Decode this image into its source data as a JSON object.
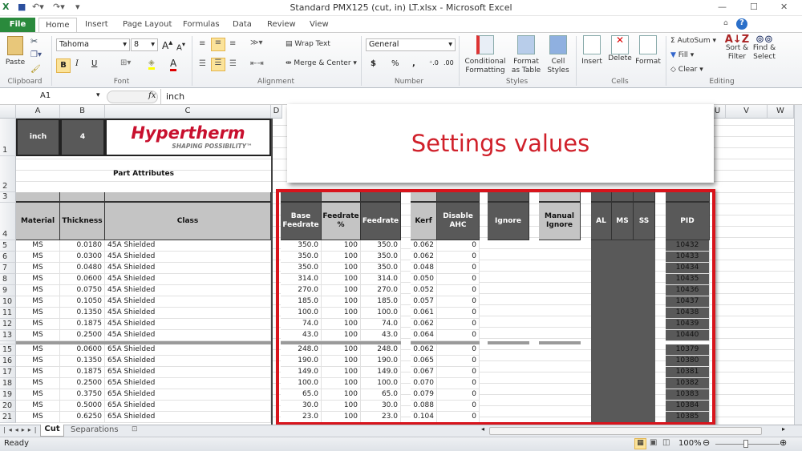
{
  "window": {
    "title": "Standard PMX125 (cut, in) LT.xlsx  -  Microsoft Excel"
  },
  "ribbon_tabs": [
    "File",
    "Home",
    "Insert",
    "Page Layout",
    "Formulas",
    "Data",
    "Review",
    "View"
  ],
  "ribbon": {
    "clipboard": {
      "paste": "Paste",
      "group": "Clipboard"
    },
    "font": {
      "name": "Tahoma",
      "size": "8",
      "bold": "B",
      "italic": "I",
      "underline": "U",
      "group": "Font"
    },
    "alignment": {
      "wrap": "Wrap Text",
      "merge": "Merge & Center",
      "group": "Alignment"
    },
    "number": {
      "format": "General",
      "currency": "$",
      "percent": "%",
      "comma": ",",
      "group": "Number"
    },
    "styles": {
      "conditional": "Conditional Formatting",
      "format_table": "Format as Table",
      "cell_styles": "Cell Styles",
      "group": "Styles"
    },
    "cells": {
      "insert": "Insert",
      "delete": "Delete",
      "format": "Format",
      "group": "Cells"
    },
    "editing": {
      "autosum": "AutoSum",
      "fill": "Fill",
      "clear": "Clear",
      "sort": "Sort & Filter",
      "find": "Find & Select",
      "group": "Editing"
    }
  },
  "formula_bar": {
    "name_box": "A1",
    "fx": "fx",
    "value": "inch"
  },
  "columns": [
    "A",
    "B",
    "C",
    "D",
    "U",
    "V",
    "W"
  ],
  "sheet": {
    "a1": "inch",
    "b1": "4",
    "logo": {
      "brand": "Hypertherm",
      "tagline": "SHAPING POSSIBILITY™"
    },
    "part_attributes": "Part Attributes",
    "headers": {
      "material": "Material",
      "thickness": "Thickness",
      "class": "Class",
      "base_feedrate": "Base Feedrate",
      "feedrate_pct": "Feedrate %",
      "feedrate": "Feedrate",
      "kerf": "Kerf",
      "disable_ahc": "Disable AHC",
      "ignore": "Ignore",
      "manual_ignore": "Manual Ignore",
      "al": "AL",
      "ms": "MS",
      "ss": "SS",
      "pid": "PID"
    },
    "rows": [
      {
        "n": "5",
        "mat": "MS",
        "th": "0.0180",
        "cls": "45A Shielded",
        "bf": "350.0",
        "fp": "100",
        "fr": "350.0",
        "kerf": "0.062",
        "ahc": "0",
        "pid": "10432"
      },
      {
        "n": "6",
        "mat": "MS",
        "th": "0.0300",
        "cls": "45A Shielded",
        "bf": "350.0",
        "fp": "100",
        "fr": "350.0",
        "kerf": "0.062",
        "ahc": "0",
        "pid": "10433"
      },
      {
        "n": "7",
        "mat": "MS",
        "th": "0.0480",
        "cls": "45A Shielded",
        "bf": "350.0",
        "fp": "100",
        "fr": "350.0",
        "kerf": "0.048",
        "ahc": "0",
        "pid": "10434"
      },
      {
        "n": "8",
        "mat": "MS",
        "th": "0.0600",
        "cls": "45A Shielded",
        "bf": "314.0",
        "fp": "100",
        "fr": "314.0",
        "kerf": "0.050",
        "ahc": "0",
        "pid": "10435"
      },
      {
        "n": "9",
        "mat": "MS",
        "th": "0.0750",
        "cls": "45A Shielded",
        "bf": "270.0",
        "fp": "100",
        "fr": "270.0",
        "kerf": "0.052",
        "ahc": "0",
        "pid": "10436"
      },
      {
        "n": "10",
        "mat": "MS",
        "th": "0.1050",
        "cls": "45A Shielded",
        "bf": "185.0",
        "fp": "100",
        "fr": "185.0",
        "kerf": "0.057",
        "ahc": "0",
        "pid": "10437"
      },
      {
        "n": "11",
        "mat": "MS",
        "th": "0.1350",
        "cls": "45A Shielded",
        "bf": "100.0",
        "fp": "100",
        "fr": "100.0",
        "kerf": "0.061",
        "ahc": "0",
        "pid": "10438"
      },
      {
        "n": "12",
        "mat": "MS",
        "th": "0.1875",
        "cls": "45A Shielded",
        "bf": "74.0",
        "fp": "100",
        "fr": "74.0",
        "kerf": "0.062",
        "ahc": "0",
        "pid": "10439"
      },
      {
        "n": "13",
        "mat": "MS",
        "th": "0.2500",
        "cls": "45A Shielded",
        "bf": "43.0",
        "fp": "100",
        "fr": "43.0",
        "kerf": "0.064",
        "ahc": "0",
        "pid": "10440"
      },
      {
        "n": "15",
        "mat": "MS",
        "th": "0.0600",
        "cls": "65A Shielded",
        "bf": "248.0",
        "fp": "100",
        "fr": "248.0",
        "kerf": "0.062",
        "ahc": "0",
        "pid": "10379"
      },
      {
        "n": "16",
        "mat": "MS",
        "th": "0.1350",
        "cls": "65A Shielded",
        "bf": "190.0",
        "fp": "100",
        "fr": "190.0",
        "kerf": "0.065",
        "ahc": "0",
        "pid": "10380"
      },
      {
        "n": "17",
        "mat": "MS",
        "th": "0.1875",
        "cls": "65A Shielded",
        "bf": "149.0",
        "fp": "100",
        "fr": "149.0",
        "kerf": "0.067",
        "ahc": "0",
        "pid": "10381"
      },
      {
        "n": "18",
        "mat": "MS",
        "th": "0.2500",
        "cls": "65A Shielded",
        "bf": "100.0",
        "fp": "100",
        "fr": "100.0",
        "kerf": "0.070",
        "ahc": "0",
        "pid": "10382"
      },
      {
        "n": "19",
        "mat": "MS",
        "th": "0.3750",
        "cls": "65A Shielded",
        "bf": "65.0",
        "fp": "100",
        "fr": "65.0",
        "kerf": "0.079",
        "ahc": "0",
        "pid": "10383"
      },
      {
        "n": "20",
        "mat": "MS",
        "th": "0.5000",
        "cls": "65A Shielded",
        "bf": "30.0",
        "fp": "100",
        "fr": "30.0",
        "kerf": "0.088",
        "ahc": "0",
        "pid": "10384"
      },
      {
        "n": "21",
        "mat": "MS",
        "th": "0.6250",
        "cls": "65A Shielded",
        "bf": "23.0",
        "fp": "100",
        "fr": "23.0",
        "kerf": "0.104",
        "ahc": "0",
        "pid": "10385"
      }
    ]
  },
  "callout": "Settings values",
  "sheet_tabs": [
    "Cut",
    "Separations"
  ],
  "status": {
    "ready": "Ready",
    "zoom": "100%"
  },
  "colors": {
    "dark_header": "#595959",
    "light_header": "#c4c4c4",
    "highlight": "#d8141c",
    "brand": "#c8102e"
  }
}
